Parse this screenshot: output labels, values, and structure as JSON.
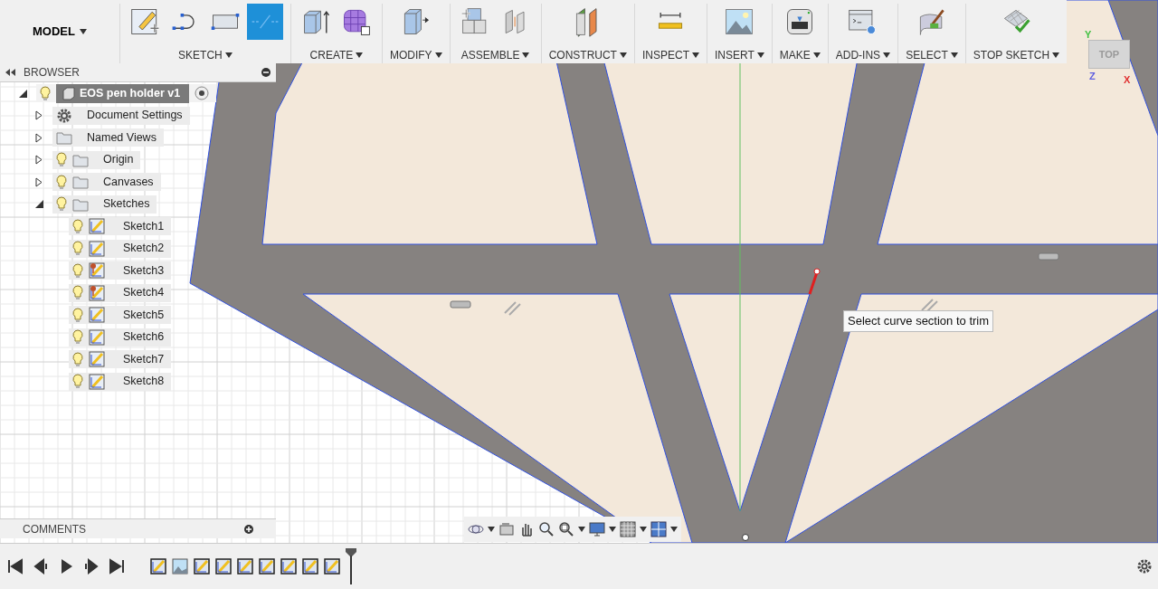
{
  "toolbar": {
    "workspace": "MODEL",
    "groups": [
      {
        "label": "SKETCH",
        "tools": [
          {
            "kind": "sketch-new",
            "selected": false
          },
          {
            "kind": "spline",
            "selected": false
          },
          {
            "kind": "rectangle",
            "selected": false
          },
          {
            "kind": "trim",
            "selected": true
          }
        ]
      },
      {
        "label": "CREATE",
        "tools": [
          {
            "kind": "extrude",
            "selected": false
          },
          {
            "kind": "form",
            "selected": false
          }
        ]
      },
      {
        "label": "MODIFY",
        "tools": [
          {
            "kind": "press-pull",
            "selected": false
          }
        ]
      },
      {
        "label": "ASSEMBLE",
        "tools": [
          {
            "kind": "joint-new",
            "selected": false
          },
          {
            "kind": "joint",
            "selected": false
          }
        ]
      },
      {
        "label": "CONSTRUCT",
        "tools": [
          {
            "kind": "plane",
            "selected": false
          }
        ]
      },
      {
        "label": "INSPECT",
        "tools": [
          {
            "kind": "measure",
            "selected": false
          }
        ]
      },
      {
        "label": "INSERT",
        "tools": [
          {
            "kind": "image",
            "selected": false
          }
        ]
      },
      {
        "label": "MAKE",
        "tools": [
          {
            "kind": "printer",
            "selected": false
          }
        ]
      },
      {
        "label": "ADD-INS",
        "tools": [
          {
            "kind": "scripts",
            "selected": false
          }
        ]
      },
      {
        "label": "SELECT",
        "tools": [
          {
            "kind": "select",
            "selected": false
          }
        ]
      },
      {
        "label": "STOP SKETCH",
        "tools": [
          {
            "kind": "stop-sketch",
            "selected": false
          }
        ]
      }
    ]
  },
  "browser": {
    "title": "BROWSER",
    "tree": [
      {
        "label": "EOS pen holder v1",
        "kind": "component",
        "expanded": true,
        "children": [
          {
            "label": "Document Settings",
            "kind": "settings",
            "expanded": false
          },
          {
            "label": "Named Views",
            "kind": "views",
            "expanded": false
          },
          {
            "label": "Origin",
            "kind": "folder",
            "expanded": false
          },
          {
            "label": "Canvases",
            "kind": "folder",
            "expanded": false
          },
          {
            "label": "Sketches",
            "kind": "folder",
            "expanded": true,
            "children": [
              {
                "label": "Sketch1",
                "kind": "sketch",
                "pinned": false
              },
              {
                "label": "Sketch2",
                "kind": "sketch",
                "pinned": false
              },
              {
                "label": "Sketch3",
                "kind": "sketch",
                "pinned": true
              },
              {
                "label": "Sketch4",
                "kind": "sketch",
                "pinned": true
              },
              {
                "label": "Sketch5",
                "kind": "sketch",
                "pinned": false
              },
              {
                "label": "Sketch6",
                "kind": "sketch",
                "pinned": false
              },
              {
                "label": "Sketch7",
                "kind": "sketch",
                "pinned": false
              },
              {
                "label": "Sketch8",
                "kind": "sketch",
                "pinned": false
              }
            ]
          }
        ]
      }
    ]
  },
  "tooltip": "Select curve section to trim",
  "view_cube": {
    "face": "TOP",
    "axes": [
      {
        "label": "X",
        "color": "#e03030"
      },
      {
        "label": "Y",
        "color": "#40c040"
      },
      {
        "label": "Z",
        "color": "#6060e0"
      }
    ]
  },
  "comments": {
    "title": "COMMENTS"
  },
  "timeline": {
    "items": [
      {
        "kind": "sketch"
      },
      {
        "kind": "canvas"
      },
      {
        "kind": "sketch"
      },
      {
        "kind": "sketch"
      },
      {
        "kind": "sketch"
      },
      {
        "kind": "sketch"
      },
      {
        "kind": "sketch"
      },
      {
        "kind": "sketch"
      },
      {
        "kind": "sketch"
      }
    ]
  }
}
